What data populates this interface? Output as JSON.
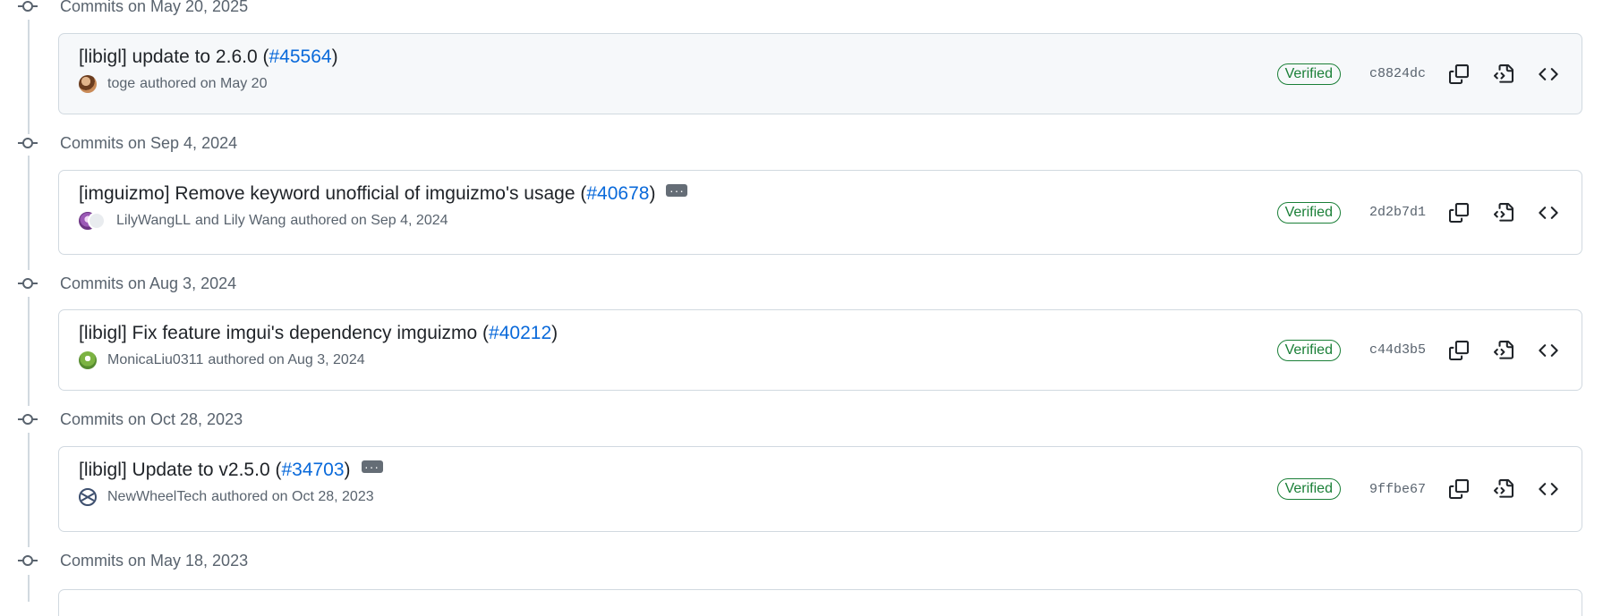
{
  "groups": [
    {
      "title": "Commits on May 20, 2025",
      "commits": [
        {
          "title_text": "[libigl] update to 2.6.0 (",
          "pr": "#45564",
          "title_end": ")",
          "authors": [
            "toge"
          ],
          "meta": "authored on May 20",
          "verified": "Verified",
          "sha": "c8824dc",
          "has_ellipsis": false
        }
      ]
    },
    {
      "title": "Commits on Sep 4, 2024",
      "commits": [
        {
          "title_text": "[imguizmo] Remove keyword unofficial of imguizmo's usage (",
          "pr": "#40678",
          "title_end": ")",
          "authors": [
            "LilyWangLL",
            "Lily Wang"
          ],
          "author_join": "and",
          "meta": "authored on Sep 4, 2024",
          "verified": "Verified",
          "sha": "2d2b7d1",
          "has_ellipsis": true
        }
      ]
    },
    {
      "title": "Commits on Aug 3, 2024",
      "commits": [
        {
          "title_text": "[libigl] Fix feature imgui's dependency imguizmo (",
          "pr": "#40212",
          "title_end": ")",
          "authors": [
            "MonicaLiu0311"
          ],
          "meta": "authored on Aug 3, 2024",
          "verified": "Verified",
          "sha": "c44d3b5",
          "has_ellipsis": false
        }
      ]
    },
    {
      "title": "Commits on Oct 28, 2023",
      "commits": [
        {
          "title_text": "[libigl] Update to v2.5.0 (",
          "pr": "#34703",
          "title_end": ")",
          "authors": [
            "NewWheelTech"
          ],
          "meta": "authored on Oct 28, 2023",
          "verified": "Verified",
          "sha": "9ffbe67",
          "has_ellipsis": true
        }
      ]
    },
    {
      "title": "Commits on May 18, 2023",
      "commits": []
    }
  ],
  "icons": {
    "copy": "copy-icon",
    "browse_file": "file-code-icon",
    "browse_repo": "code-icon",
    "node": "git-commit-icon"
  },
  "colors": {
    "link": "#0969da",
    "verified": "#1a7f37",
    "muted": "#59636e",
    "border": "#d1d9e0"
  }
}
